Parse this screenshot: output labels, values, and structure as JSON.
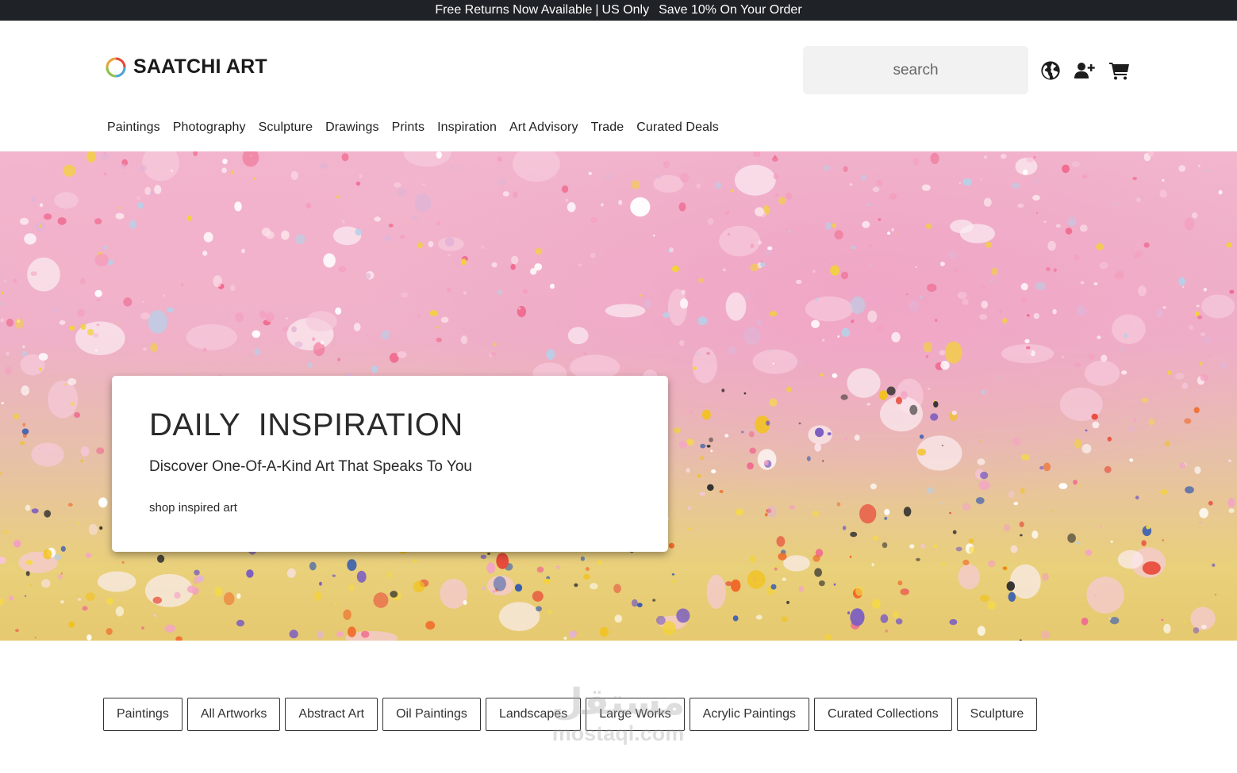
{
  "promo": {
    "part1": "Free Returns Now Available",
    "sep": "|",
    "part2": "US Only",
    "part3": "Save 10% On Your Order"
  },
  "brand": {
    "name": "SAATCHI ART"
  },
  "search": {
    "placeholder": "search"
  },
  "icons": {
    "locale": "globe-icon",
    "account": "user-plus-icon",
    "cart": "cart-icon"
  },
  "nav": {
    "items": [
      "Paintings",
      "Photography",
      "Sculpture",
      "Drawings",
      "Prints",
      "Inspiration",
      "Art Advisory",
      "Trade",
      "Curated Deals"
    ]
  },
  "hero": {
    "title": "DAILY  INSPIRATION",
    "subtitle": "Discover One-Of-A-Kind Art That Speaks To You",
    "cta": "shop inspired art"
  },
  "chips": [
    "Paintings",
    "All Artworks",
    "Abstract Art",
    "Oil Paintings",
    "Landscapes",
    "Large Works",
    "Acrylic Paintings",
    "Curated Collections",
    "Sculpture"
  ],
  "watermark": {
    "arabic": "مستقل",
    "latin": "mostaql.com"
  },
  "colors": {
    "promo_bg": "#1f2226",
    "search_bg": "#f2f2f2",
    "text": "#222222"
  }
}
